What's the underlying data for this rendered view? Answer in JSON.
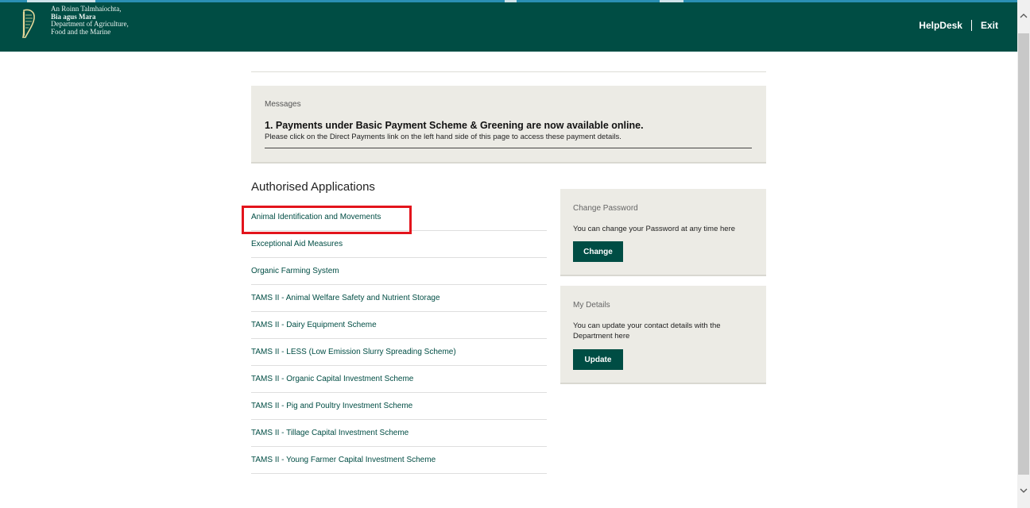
{
  "header": {
    "dept_lines": [
      "An Roinn Talmhaíochta,",
      "Bia agus Mara",
      "Department of Agriculture,",
      "Food and the Marine"
    ],
    "nav": {
      "helpdesk": "HelpDesk",
      "exit": "Exit"
    }
  },
  "messages": {
    "label": "Messages",
    "title": "1. Payments under Basic Payment Scheme & Greening are now available online.",
    "body": "Please click on the Direct Payments link on the left hand side of this page to access these payment details."
  },
  "authorised": {
    "heading": "Authorised Applications",
    "items": [
      "Animal Identification and Movements",
      "Exceptional Aid Measures",
      "Organic Farming System",
      "TAMS II - Animal Welfare Safety and Nutrient Storage",
      "TAMS II - Dairy Equipment Scheme",
      "TAMS II - LESS (Low Emission Slurry Spreading Scheme)",
      "TAMS II - Organic Capital Investment Scheme",
      "TAMS II - Pig and Poultry Investment Scheme",
      "TAMS II - Tillage Capital Investment Scheme",
      "TAMS II - Young Farmer Capital Investment Scheme"
    ]
  },
  "change_password": {
    "label": "Change Password",
    "text": "You can change your Password at any time here",
    "button": "Change"
  },
  "my_details": {
    "label": "My Details",
    "text": "You can update your contact details with the Department here",
    "button": "Update"
  },
  "colors": {
    "brand": "#004d44",
    "panel": "#ecebe5",
    "highlight": "#e3141c"
  }
}
